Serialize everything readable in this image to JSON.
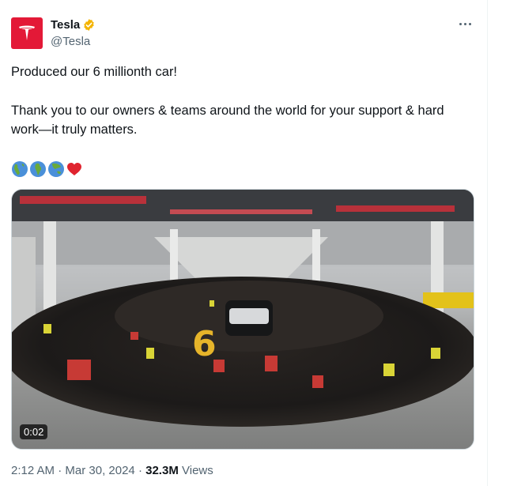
{
  "author": {
    "name": "Tesla",
    "handle": "@Tesla",
    "verified": true,
    "badge_color": "#f4b400",
    "avatar_color": "#e31937",
    "avatar_icon": "tesla-logo"
  },
  "tweet": {
    "line1": "Produced our 6 millionth car!",
    "line2": "Thank you to our owners & teams around the world for your support & hard work—it truly matters.",
    "emojis": [
      "globe-americas",
      "globe-europe-africa",
      "globe-asia-australia",
      "red-heart"
    ]
  },
  "media": {
    "type": "video",
    "duration": "0:02",
    "overlay_text": "6"
  },
  "meta": {
    "time": "2:12 AM",
    "separator": "·",
    "date": "Mar 30, 2024",
    "views_count": "32.3M",
    "views_label": "Views"
  },
  "icons": {
    "more": "more-icon",
    "verified": "verified-badge-icon"
  }
}
